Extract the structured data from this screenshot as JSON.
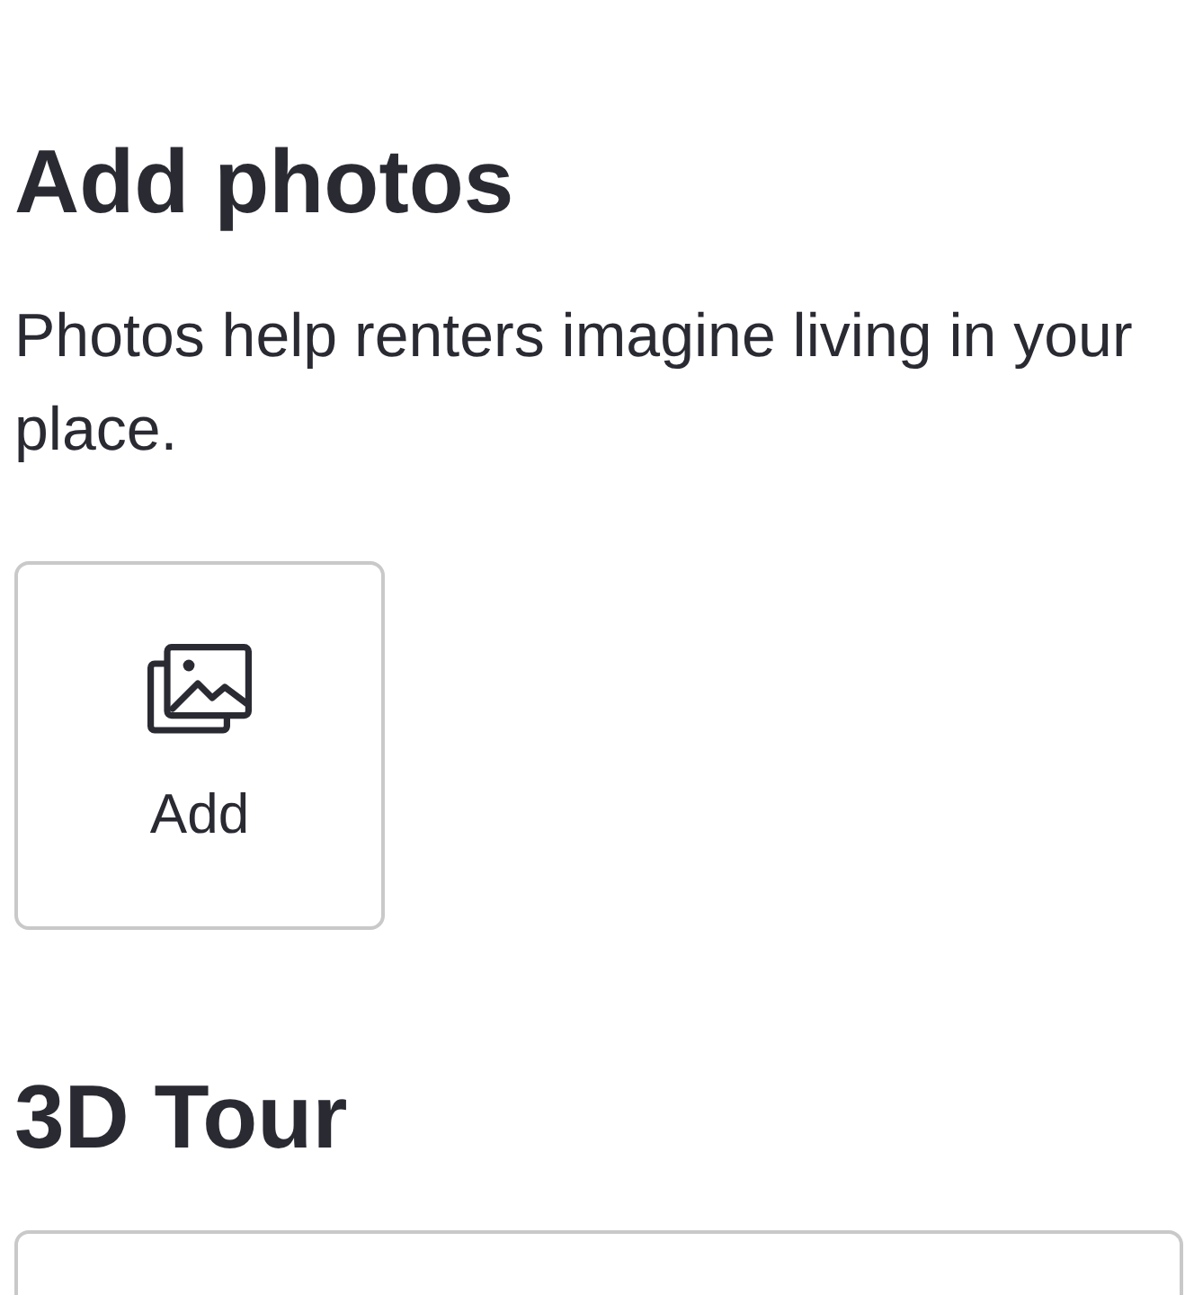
{
  "photos_section": {
    "heading": "Add photos",
    "description": "Photos help renters imagine living in your place.",
    "add_tile": {
      "label": "Add"
    }
  },
  "tour_section": {
    "heading": "3D Tour"
  }
}
